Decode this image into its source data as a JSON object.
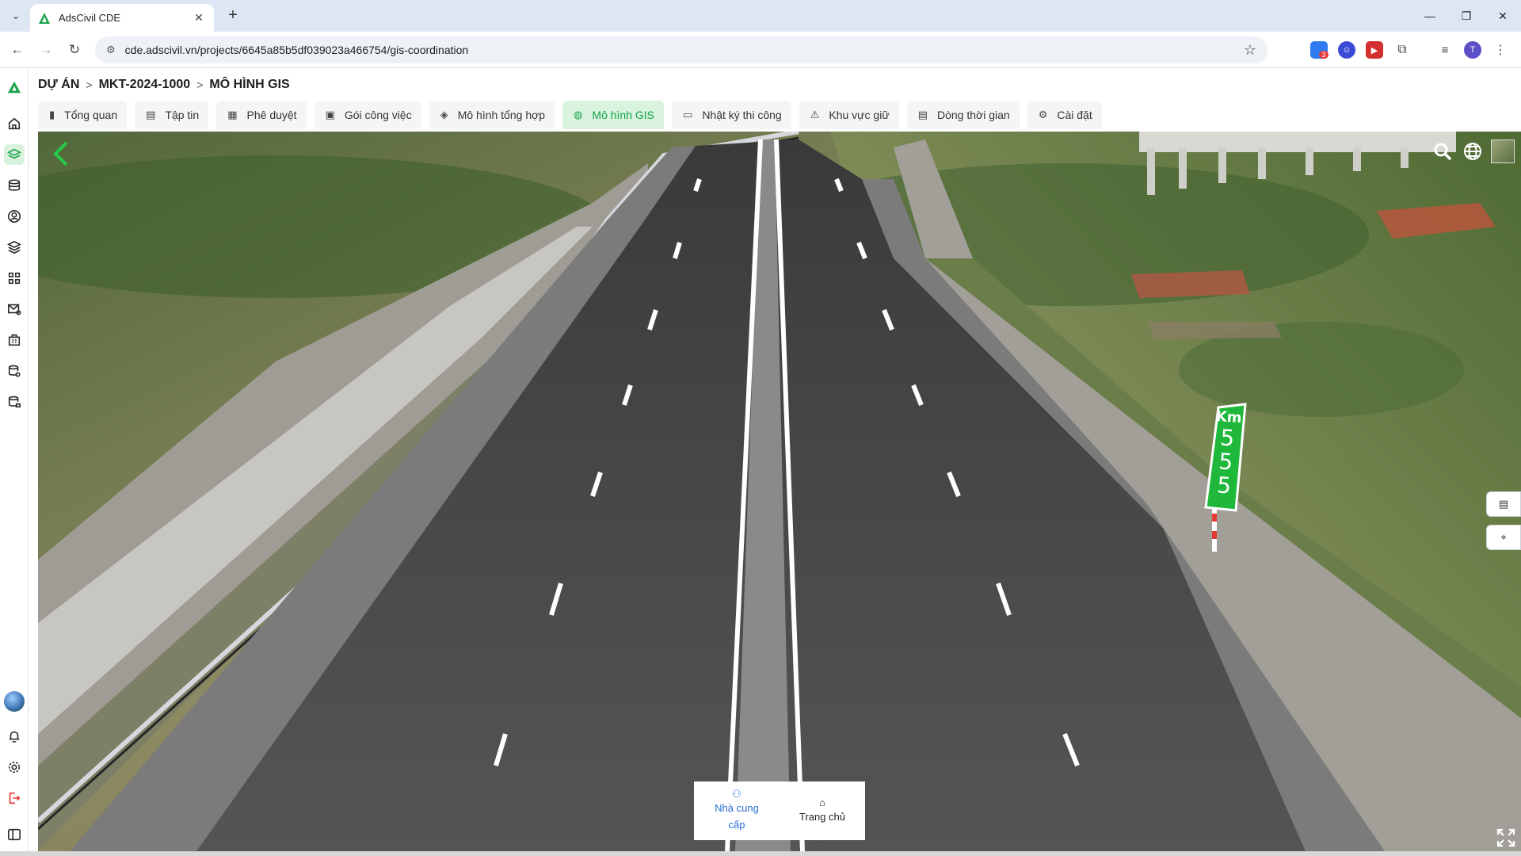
{
  "browser": {
    "tab_title": "AdsCivil CDE",
    "tab_close": "✕",
    "new_tab": "+",
    "url": "cde.adscivil.vn/projects/6645a85b5df039023a466754/gis-coordination",
    "profile_initial": "T",
    "extension_badge": "3"
  },
  "breadcrumb": {
    "root": "DỰ ÁN",
    "project": "MKT-2024-1000",
    "current": "MÔ HÌNH GIS"
  },
  "tabs": [
    {
      "label": "Tổng quan",
      "icon": "bar-chart-icon"
    },
    {
      "label": "Tập tin",
      "icon": "file-icon"
    },
    {
      "label": "Phê duyệt",
      "icon": "approval-icon"
    },
    {
      "label": "Gói công việc",
      "icon": "package-icon"
    },
    {
      "label": "Mô hình tổng hợp",
      "icon": "model-icon"
    },
    {
      "label": "Mô hình GIS",
      "icon": "globe-icon",
      "active": true
    },
    {
      "label": "Nhật ký thi công",
      "icon": "log-icon"
    },
    {
      "label": "Khu vực giữ",
      "icon": "warning-icon"
    },
    {
      "label": "Dòng thời gian",
      "icon": "timeline-icon"
    },
    {
      "label": "Cài đặt",
      "icon": "gear-icon"
    }
  ],
  "viewer": {
    "km_sign": {
      "prefix": "Km",
      "digits": [
        "5",
        "5",
        "5"
      ]
    },
    "bottom_nav": {
      "provider_label": "Nhà cung cấp",
      "home_label": "Trang chủ"
    }
  },
  "colors": {
    "accent": "#1aa34a",
    "active_tab_bg": "#d9f3df",
    "link_blue": "#2b6fd0",
    "sign_green": "#1fb83a"
  }
}
